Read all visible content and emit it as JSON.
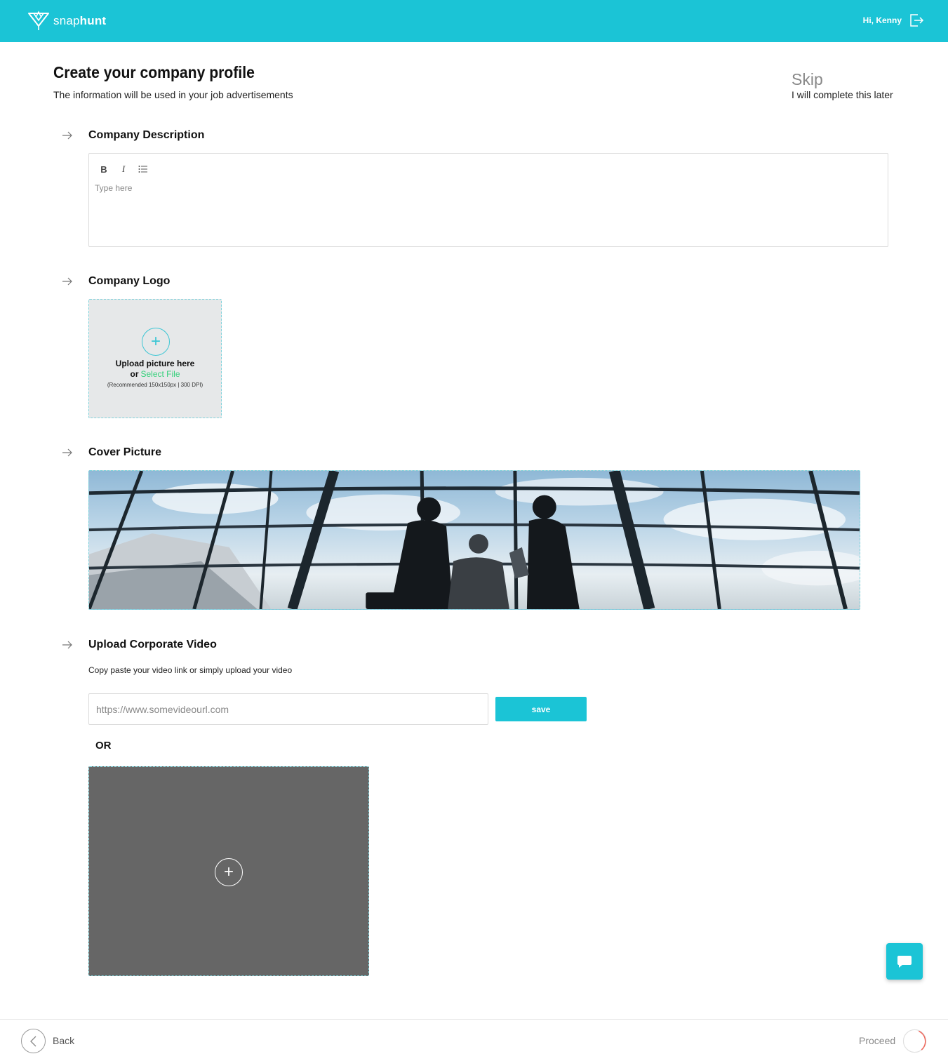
{
  "header": {
    "brand_light": "snap",
    "brand_bold": "hunt",
    "greeting": "Hi, Kenny",
    "logout_icon": "logout-icon",
    "bg_color": "#1bc4d6"
  },
  "intro": {
    "title": "Create your company profile",
    "subtitle": "The information will be used in your job advertisements",
    "skip_label": "Skip",
    "skip_sub": "I will complete this later"
  },
  "sections": {
    "description": {
      "title": "Company Description",
      "toolbar": {
        "bold": "B",
        "italic": "I",
        "list_icon": "bulleted-list-icon"
      },
      "placeholder": "Type here"
    },
    "logo": {
      "title": "Company Logo",
      "line1": "Upload picture here",
      "line2_prefix": "or",
      "select_file": "Select File",
      "recommendation": "(Recommended 150x150px | 300 DPI)"
    },
    "cover": {
      "title": "Cover Picture"
    },
    "video": {
      "title": "Upload Corporate Video",
      "description": "Copy paste your video link or simply upload your video",
      "placeholder": "https://www.somevideourl.com",
      "save_label": "save",
      "or_label": "OR"
    }
  },
  "footer": {
    "back_label": "Back",
    "proceed_label": "Proceed"
  },
  "colors": {
    "accent": "#1bc4d6",
    "link_green": "#34d07a",
    "proceed_ring": "#f06a5e"
  }
}
